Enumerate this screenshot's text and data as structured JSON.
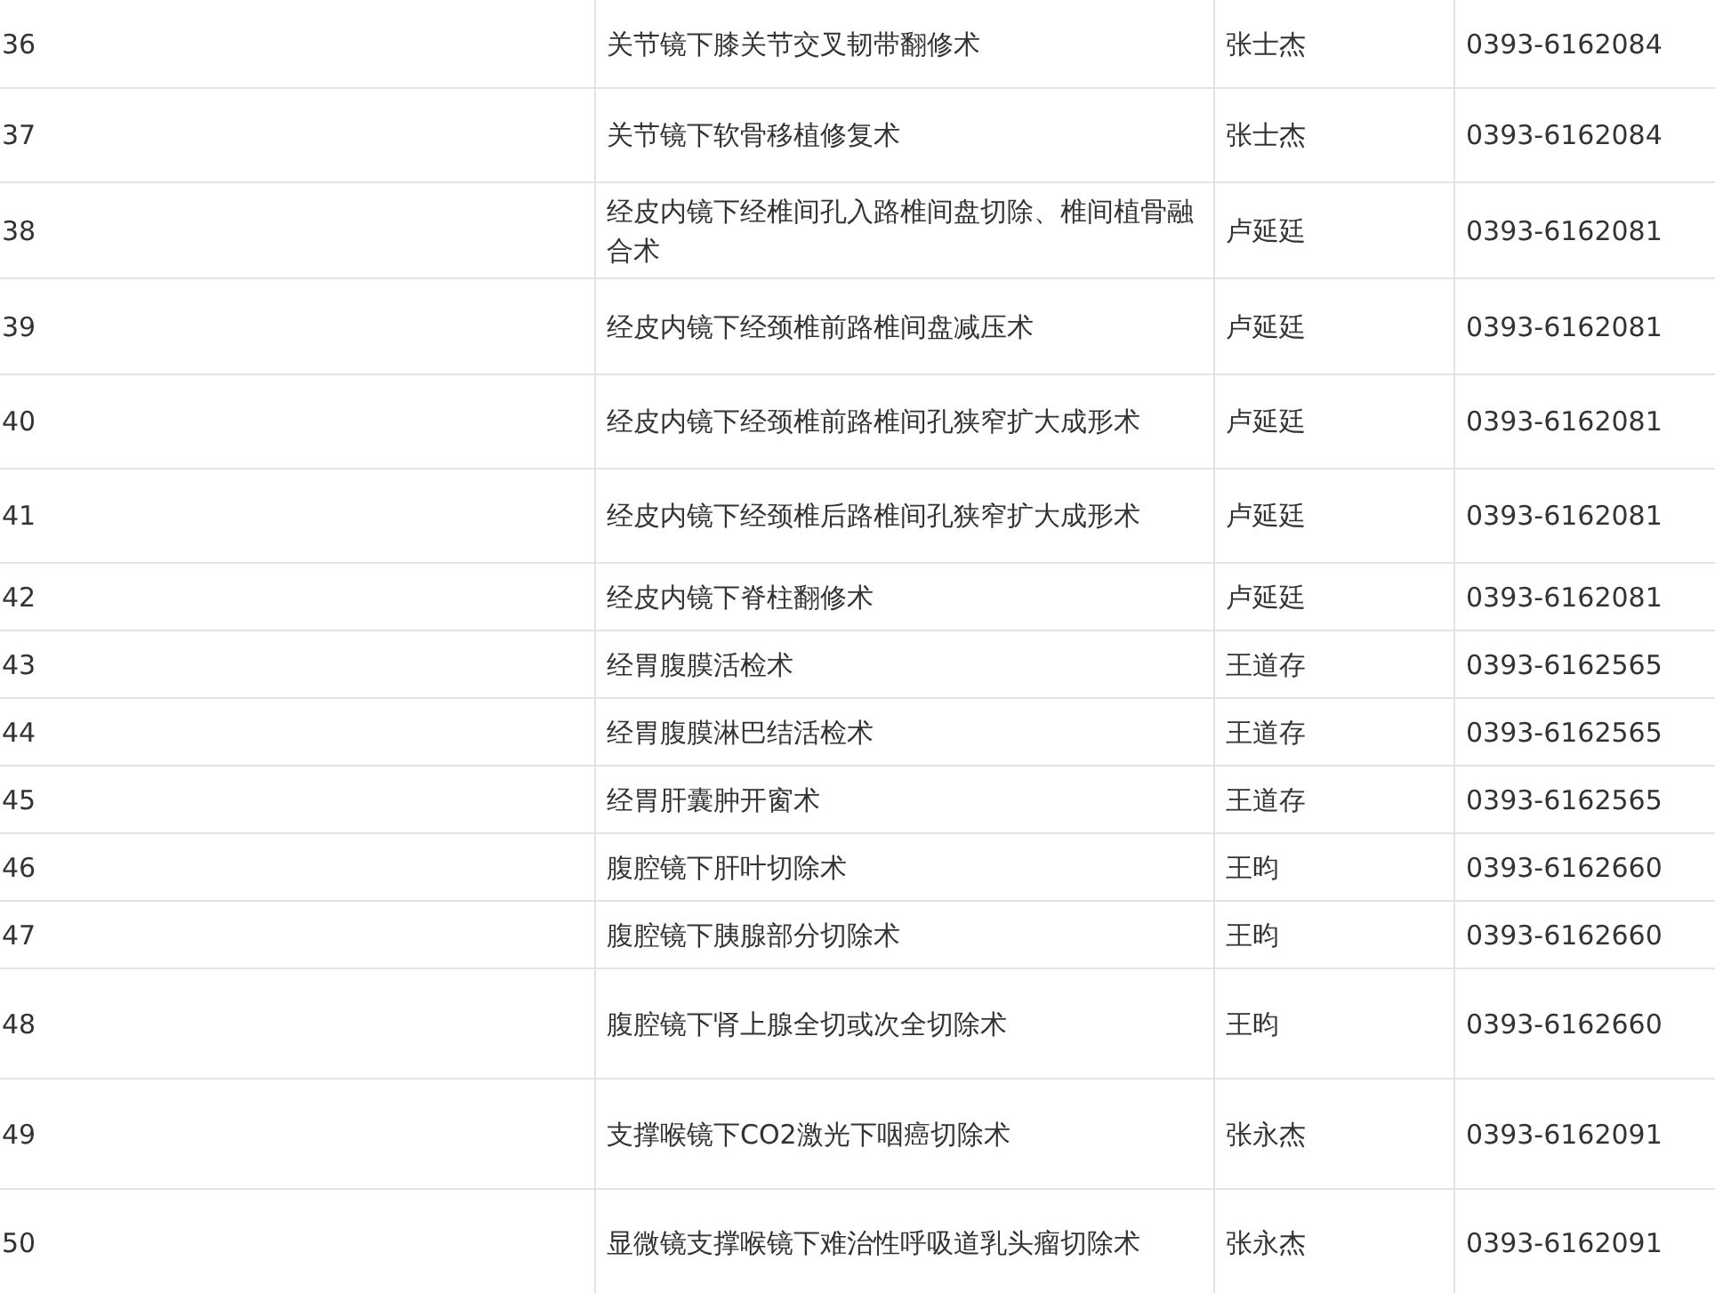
{
  "table": {
    "rows": [
      {
        "number": "36",
        "procedure": "关节镜下膝关节交叉韧带翻修术",
        "doctor": "张士杰",
        "phone": "0393-6162084"
      },
      {
        "number": "37",
        "procedure": "关节镜下软骨移植修复术",
        "doctor": "张士杰",
        "phone": "0393-6162084"
      },
      {
        "number": "38",
        "procedure": "经皮内镜下经椎间孔入路椎间盘切除、椎间植骨融合术",
        "doctor": "卢延廷",
        "phone": "0393-6162081"
      },
      {
        "number": "39",
        "procedure": "经皮内镜下经颈椎前路椎间盘减压术",
        "doctor": "卢延廷",
        "phone": "0393-6162081"
      },
      {
        "number": "40",
        "procedure": "经皮内镜下经颈椎前路椎间孔狭窄扩大成形术",
        "doctor": "卢延廷",
        "phone": "0393-6162081"
      },
      {
        "number": "41",
        "procedure": "经皮内镜下经颈椎后路椎间孔狭窄扩大成形术",
        "doctor": "卢延廷",
        "phone": "0393-6162081"
      },
      {
        "number": "42",
        "procedure": "经皮内镜下脊柱翻修术",
        "doctor": "卢延廷",
        "phone": "0393-6162081"
      },
      {
        "number": "43",
        "procedure": "经胃腹膜活检术",
        "doctor": "王道存",
        "phone": "0393-6162565"
      },
      {
        "number": "44",
        "procedure": "经胃腹膜淋巴结活检术",
        "doctor": "王道存",
        "phone": "0393-6162565"
      },
      {
        "number": "45",
        "procedure": "经胃肝囊肿开窗术",
        "doctor": "王道存",
        "phone": "0393-6162565"
      },
      {
        "number": "46",
        "procedure": "腹腔镜下肝叶切除术",
        "doctor": "王昀",
        "phone": "0393-6162660"
      },
      {
        "number": "47",
        "procedure": "腹腔镜下胰腺部分切除术",
        "doctor": "王昀",
        "phone": "0393-6162660"
      },
      {
        "number": "48",
        "procedure": "腹腔镜下肾上腺全切或次全切除术",
        "doctor": "王昀",
        "phone": "0393-6162660"
      },
      {
        "number": "49",
        "procedure": "支撑喉镜下CO2激光下咽癌切除术",
        "doctor": "张永杰",
        "phone": "0393-6162091"
      },
      {
        "number": "50",
        "procedure": "显微镜支撑喉镜下难治性呼吸道乳头瘤切除术",
        "doctor": "张永杰",
        "phone": "0393-6162091"
      }
    ]
  }
}
